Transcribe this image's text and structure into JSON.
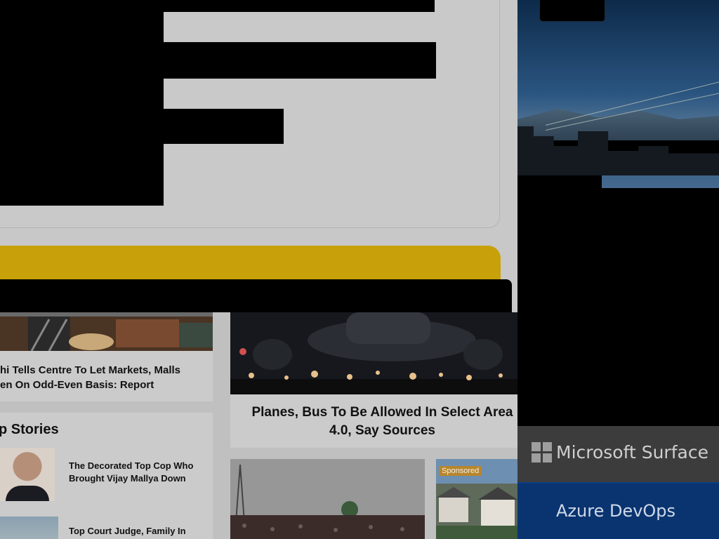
{
  "news": {
    "story1_title": "hi Tells Centre To Let Markets, Malls",
    "story1_title_line2": "en On Odd-Even Basis: Report",
    "story2_title_line1": "Planes, Bus To Be Allowed In Select Area",
    "story2_title_line2": "4.0, Say Sources",
    "section_heading": "p Stories",
    "top_story_1": "The Decorated Top Cop Who Brought Vijay Mallya Down",
    "top_story_2": "Top Court Judge, Family In",
    "sponsored_label": "Sponsored"
  },
  "ads": {
    "ms_surface": "Microsoft Surface",
    "azure_devops": "Azure DevOps"
  },
  "colors": {
    "yellow_bar": "#c8a009",
    "azure_bg": "#0a3470",
    "ms_bg": "#3c3c3c"
  }
}
